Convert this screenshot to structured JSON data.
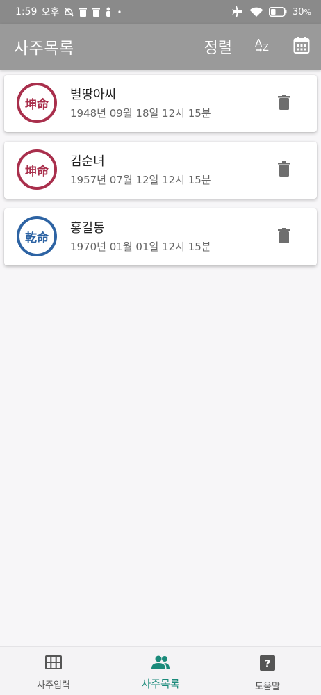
{
  "status_bar": {
    "time": "1:59",
    "ampm": "오후",
    "battery": "30",
    "battery_suffix": "%"
  },
  "app_bar": {
    "title": "사주목록",
    "sort_label": "정렬",
    "az_icon": "sort-az-icon",
    "calendar_icon": "calendar-icon"
  },
  "saju_list": [
    {
      "name": "별땅아씨",
      "date": "1948년 09월 18일 12시 15분",
      "badge": "坤命",
      "badge_color": "#a92f4c"
    },
    {
      "name": "김순녀",
      "date": "1957년 07월 12일 12시 15분",
      "badge": "坤命",
      "badge_color": "#a92f4c"
    },
    {
      "name": "홍길동",
      "date": "1970년 01월 01일 12시 15분",
      "badge": "乾命",
      "badge_color": "#2d63a3"
    }
  ],
  "bottom_nav": {
    "items": [
      {
        "label": "사주입력",
        "icon": "grid-icon"
      },
      {
        "label": "사주목록",
        "icon": "people-icon",
        "active": true
      },
      {
        "label": "도움말",
        "icon": "help-icon"
      }
    ],
    "active_color": "#1a8a7a"
  }
}
